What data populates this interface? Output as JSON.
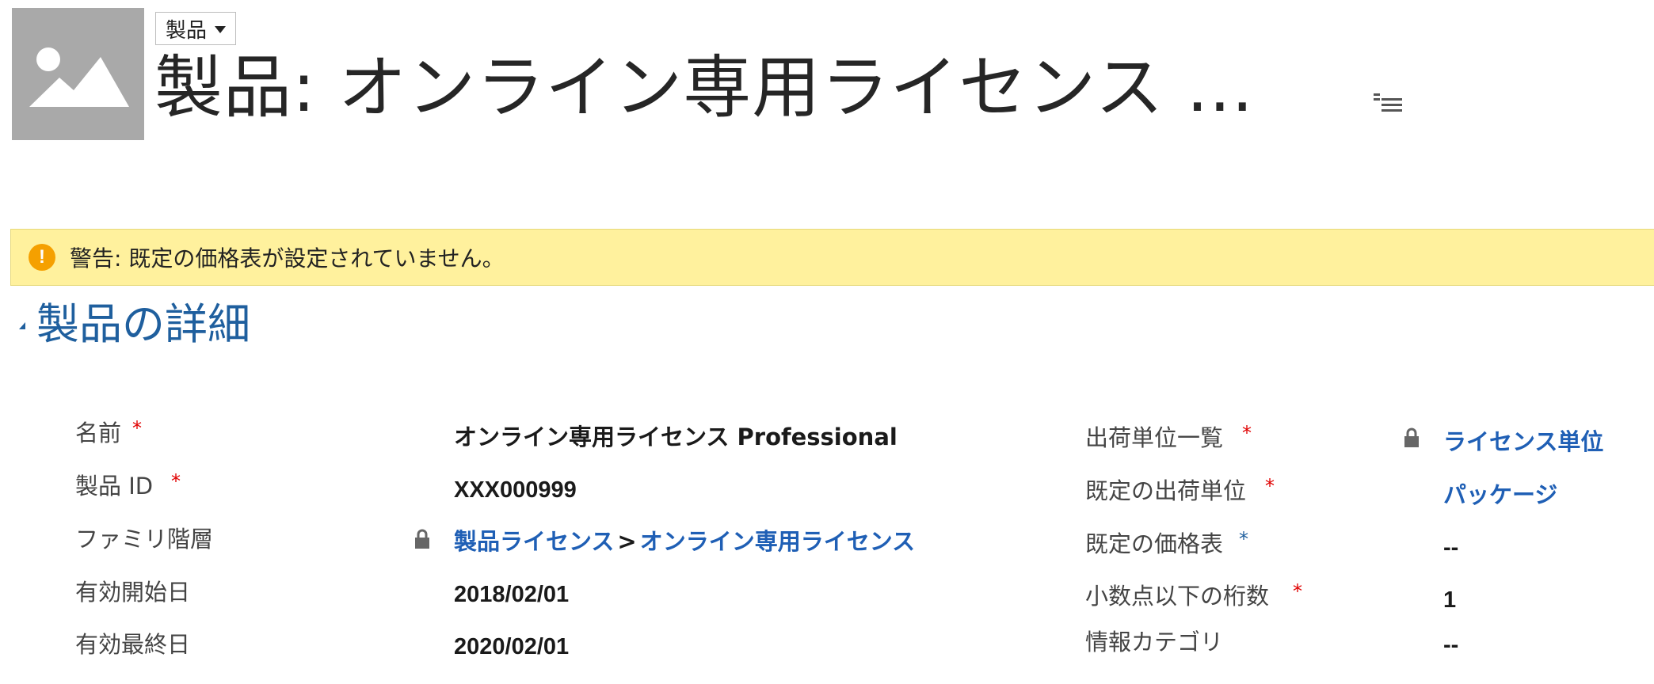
{
  "header": {
    "entity_picker_label": "製品",
    "record_title": "製品: オンライン専用ライセンス ..."
  },
  "warning": {
    "text": "警告: 既定の価格表が設定されていません。"
  },
  "section": {
    "title": "製品の詳細"
  },
  "fields_left": [
    {
      "label": "名前",
      "required": true,
      "value": "オンライン専用ライセンス Professional"
    },
    {
      "label": "製品 ID",
      "required": true,
      "value": "XXX000999"
    },
    {
      "label": "ファミリ階層",
      "required": false,
      "value_parts": [
        "製品ライセンス",
        ">",
        "オンライン専用ライセンス"
      ]
    },
    {
      "label": "有効開始日",
      "required": false,
      "value": "2018/02/01"
    },
    {
      "label": "有効最終日",
      "required": false,
      "value": "2020/02/01"
    }
  ],
  "fields_right": [
    {
      "label": "出荷単位一覧",
      "required": true,
      "value": "ライセンス単位"
    },
    {
      "label": "既定の出荷単位",
      "required": true,
      "value": "パッケージ"
    },
    {
      "label": "既定の価格表",
      "recommended": true,
      "value": "--"
    },
    {
      "label": "小数点以下の桁数",
      "required": true,
      "value": "1"
    },
    {
      "label": "情報カテゴリ",
      "required": false,
      "value": "--"
    }
  ],
  "colors": {
    "accent": "#1f5f9e",
    "link": "#1f5fb5",
    "warning_bg": "#fff19d",
    "required": "#e00000"
  },
  "icons": {
    "thumbnail": "image-placeholder-icon",
    "warning": "warning-icon",
    "lock": "lock-icon",
    "menu": "menu-icon"
  }
}
